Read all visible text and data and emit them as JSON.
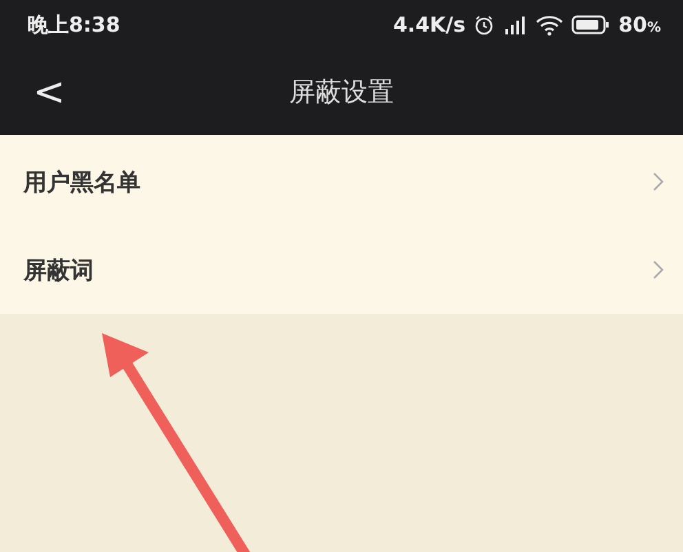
{
  "status_bar": {
    "time": "晚上8:38",
    "speed": "4.4K/s",
    "battery_percent": "80",
    "battery_unit": "%"
  },
  "nav_bar": {
    "back": "<",
    "title": "屏蔽设置"
  },
  "items": [
    {
      "label": "用户黑名单"
    },
    {
      "label": "屏蔽词"
    }
  ]
}
